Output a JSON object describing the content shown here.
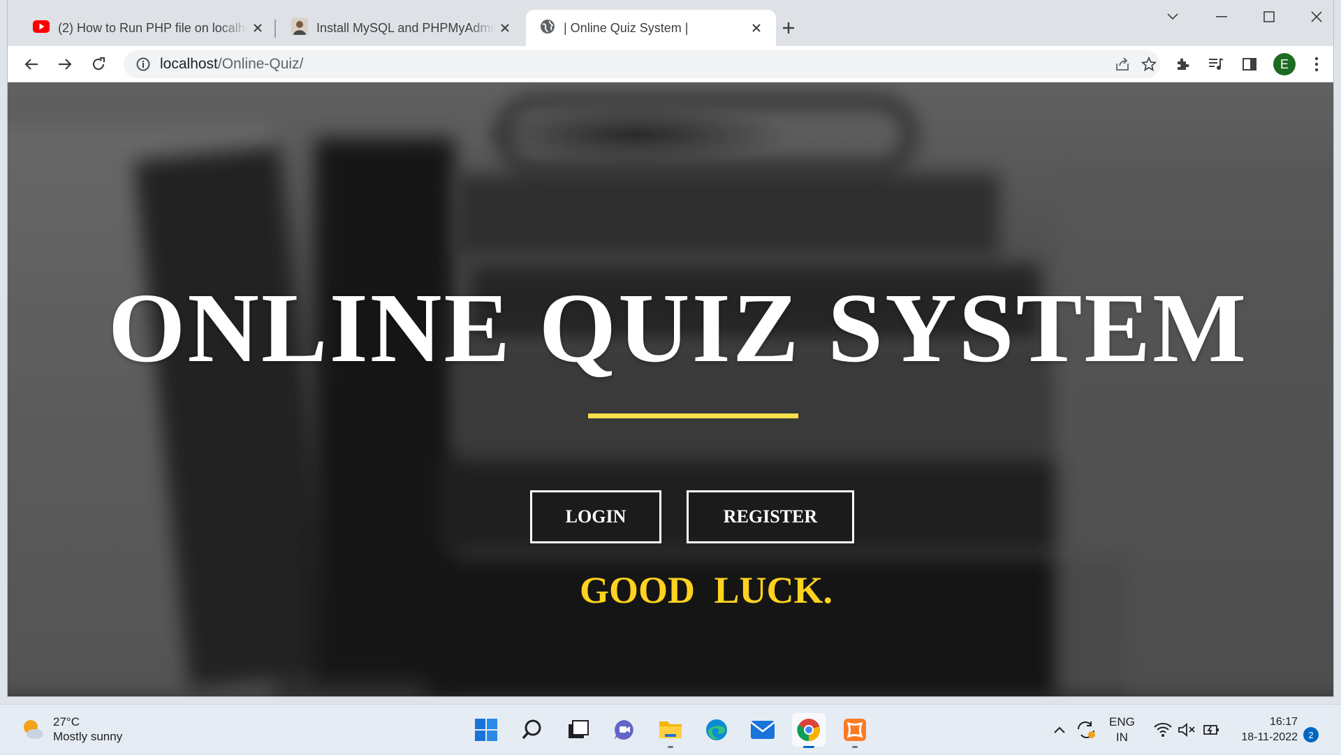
{
  "browser": {
    "tabs": [
      {
        "title": "(2) How to Run PHP file on localhost",
        "icon": "youtube-icon",
        "active": false
      },
      {
        "title": "Install MySQL and PHPMyAdmin",
        "icon": "avatar-icon",
        "active": false
      },
      {
        "title": "| Online Quiz System |",
        "icon": "globe-icon",
        "active": true
      }
    ],
    "url_host": "localhost",
    "url_path": "/Online-Quiz/",
    "profile_initial": "E"
  },
  "page": {
    "title": "ONLINE QUIZ SYSTEM",
    "login_label": "LOGIN",
    "register_label": "REGISTER",
    "goodluck": "GOOD  LUCK.",
    "accent_color": "#f5e04a",
    "goodluck_color": "#ffd21f"
  },
  "taskbar": {
    "weather_temp": "27°C",
    "weather_desc": "Mostly sunny",
    "lang_top": "ENG",
    "lang_bottom": "IN",
    "time": "16:17",
    "date": "18-11-2022",
    "notification_count": "2",
    "apps": [
      "start-icon",
      "search-icon",
      "task-view-icon",
      "teams-chat-icon",
      "file-explorer-icon",
      "edge-icon",
      "mail-icon",
      "chrome-icon",
      "xampp-icon"
    ]
  }
}
